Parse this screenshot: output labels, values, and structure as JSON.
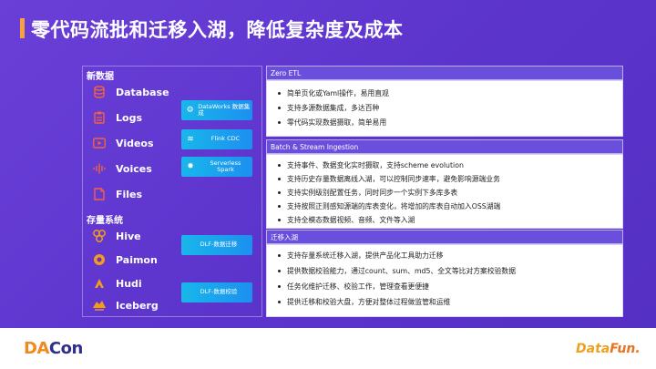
{
  "title": "零代码流批和迁移入湖，降低复杂度及成本",
  "left": {
    "new_data_label": "新数据",
    "sources": [
      {
        "label": "Database",
        "icon": "database-icon"
      },
      {
        "label": "Logs",
        "icon": "logs-icon"
      },
      {
        "label": "Videos",
        "icon": "video-icon"
      },
      {
        "label": "Voices",
        "icon": "voice-wave-icon"
      },
      {
        "label": "Files",
        "icon": "file-icon"
      }
    ],
    "storage_label": "存量系统",
    "storage": [
      {
        "label": "Hive",
        "icon": "hive-icon"
      },
      {
        "label": "Paimon",
        "icon": "paimon-icon"
      },
      {
        "label": "Hudi",
        "icon": "hudi-icon"
      },
      {
        "label": "Iceberg",
        "icon": "iceberg-icon"
      }
    ]
  },
  "chips": {
    "dataworks": "DataWorks 数据集成",
    "flink": "Flink CDC",
    "serverless_1": "Serverless",
    "serverless_2": "Spark",
    "dlf1": "DLF-数据迁移",
    "dlf2": "DLF-数据校验"
  },
  "right": {
    "zero_etl": {
      "header": "Zero ETL",
      "items": [
        "简单页化或Yaml操作，易用直观",
        "支持多源数据集成，多达百种",
        "零代码实现数据摄取，简单易用"
      ]
    },
    "batch_stream": {
      "header": "Batch & Stream Ingestion",
      "items": [
        "支持事件、数据变化实时摄取，支持scheme evolution",
        "支持历史存量数据离线入湖，可以控制同步速率，避免影响源端业务",
        "支持实例级别配置任务，同时同步一个实例下多库多表",
        "支持按照正则感知源端的库表变化，将增加的库表自动加入OSS湖端",
        "支持全模态数据视频、音频、文件等入湖"
      ]
    },
    "migration": {
      "header": "迁移入湖",
      "items": [
        "支持存量系统迁移入湖，提供产品化工具助力迁移",
        "提供数据校验能力，通过count、sum、md5、全文等比对方案校验数据",
        "任务化维护迁移、校验工作，管理查看更便捷",
        "提供迁移和校验大盘，方便对整体过程做监管和运维"
      ]
    }
  },
  "footer": {
    "left_logo_a": "DA",
    "left_logo_b": "Con",
    "right_logo_a": "Data",
    "right_logo_b": "Fun."
  }
}
